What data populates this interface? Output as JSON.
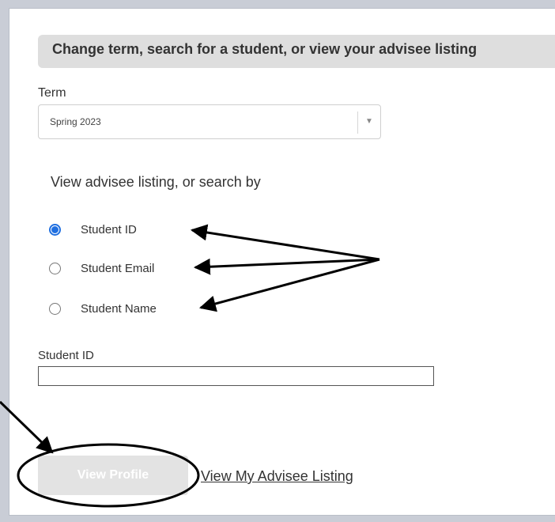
{
  "header": {
    "title": "Change term, search for a student, or view your advisee listing"
  },
  "term": {
    "label": "Term",
    "selected": "Spring 2023"
  },
  "search": {
    "section_label": "View advisee listing, or search by",
    "options": [
      {
        "label": "Student ID",
        "checked": true
      },
      {
        "label": "Student Email",
        "checked": false
      },
      {
        "label": "Student Name",
        "checked": false
      }
    ]
  },
  "student_field": {
    "label": "Student ID",
    "value": ""
  },
  "actions": {
    "view_profile": "View Profile",
    "view_advisee_listing": "View My Advisee Listing"
  },
  "colors": {
    "accent": "#1f6fe0",
    "header_bg": "#dedede",
    "page_bg": "#c9cdd6"
  }
}
